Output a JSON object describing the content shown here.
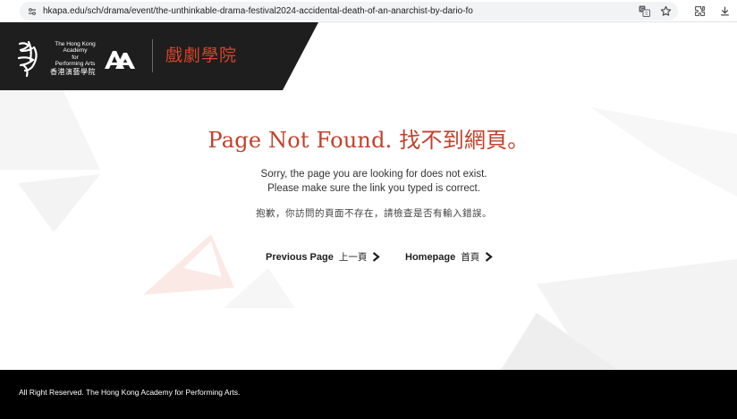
{
  "browser": {
    "url": "hkapa.edu/sch/drama/event/the-unthinkable-drama-festival2024-accidental-death-of-an-anarchist-by-dario-fo",
    "icons": [
      "site-info-icon",
      "translate-icon",
      "bookmark-star-icon",
      "extensions-icon",
      "download-icon"
    ]
  },
  "header": {
    "academy_en_line1": "The Hong Kong Academy",
    "academy_en_line2": "for",
    "academy_en_line3": "Performing Arts",
    "academy_zh": "香港演藝學院",
    "department": "戲劇學院",
    "colors": {
      "band": "#1e1e1e",
      "accent": "#d8432a"
    }
  },
  "content": {
    "title": "Page Not Found. 找不到網頁。",
    "message_en_1": "Sorry, the page you are looking for does not exist.",
    "message_en_2": "Please make sure the link you typed is correct.",
    "message_zh": "抱歉，你訪問的頁面不存在，請檢查是否有輸入錯誤。",
    "links": {
      "previous": {
        "label": "Previous Page",
        "label_zh": "上一頁",
        "icon": "chevron-right-icon"
      },
      "home": {
        "label": "Homepage",
        "label_zh": "首頁",
        "icon": "chevron-right-icon"
      }
    },
    "colors": {
      "title": "#c2412a"
    }
  },
  "footer": {
    "copyright": "All Right Reserved. The Hong Kong Academy for Performing Arts."
  }
}
